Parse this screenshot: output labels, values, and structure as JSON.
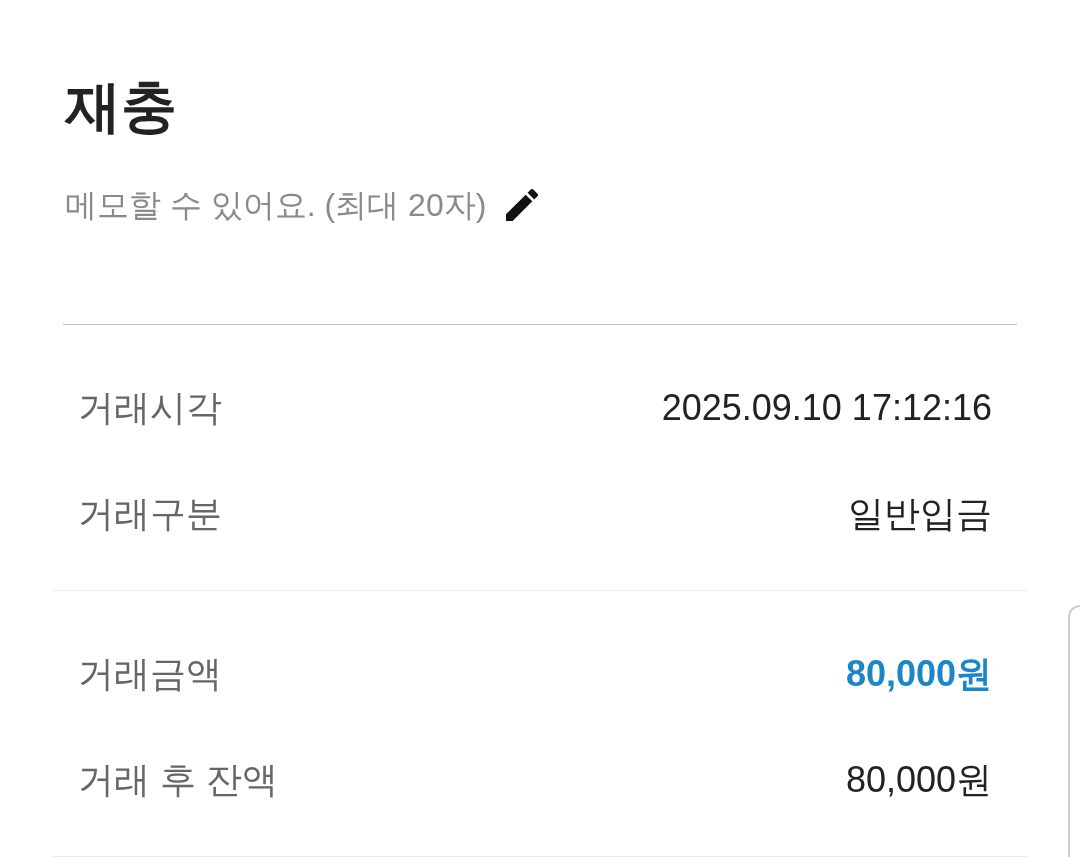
{
  "header": {
    "title": "재충",
    "memo": {
      "hint": "메모할 수 있어요. (최대 20자)"
    }
  },
  "sections": [
    {
      "rows": [
        {
          "label": "거래시각",
          "value": "2025.09.10 17:12:16",
          "highlighted": false
        },
        {
          "label": "거래구분",
          "value": "일반입금",
          "highlighted": false
        }
      ]
    },
    {
      "rows": [
        {
          "label": "거래금액",
          "value": "80,000원",
          "highlighted": true
        },
        {
          "label": "거래 후 잔액",
          "value": "80,000원",
          "highlighted": false
        }
      ]
    }
  ]
}
